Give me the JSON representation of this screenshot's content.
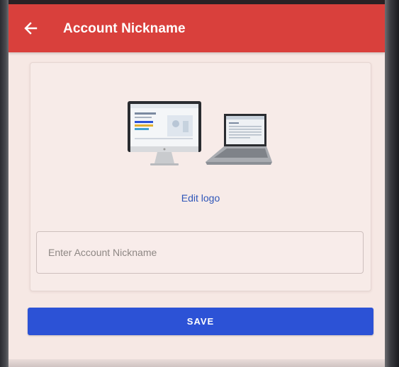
{
  "appbar": {
    "title": "Account Nickname",
    "back_icon": "arrow-left-icon",
    "color": "#d9403c"
  },
  "card": {
    "logo_image": "computer-and-laptop-illustration",
    "edit_logo_label": "Edit logo",
    "nickname_input": {
      "value": "",
      "placeholder": "Enter Account Nickname"
    }
  },
  "save_button": {
    "label": "SAVE",
    "color": "#2c52d6"
  },
  "colors": {
    "background": "#f6e8e4",
    "link": "#2f56b8"
  }
}
